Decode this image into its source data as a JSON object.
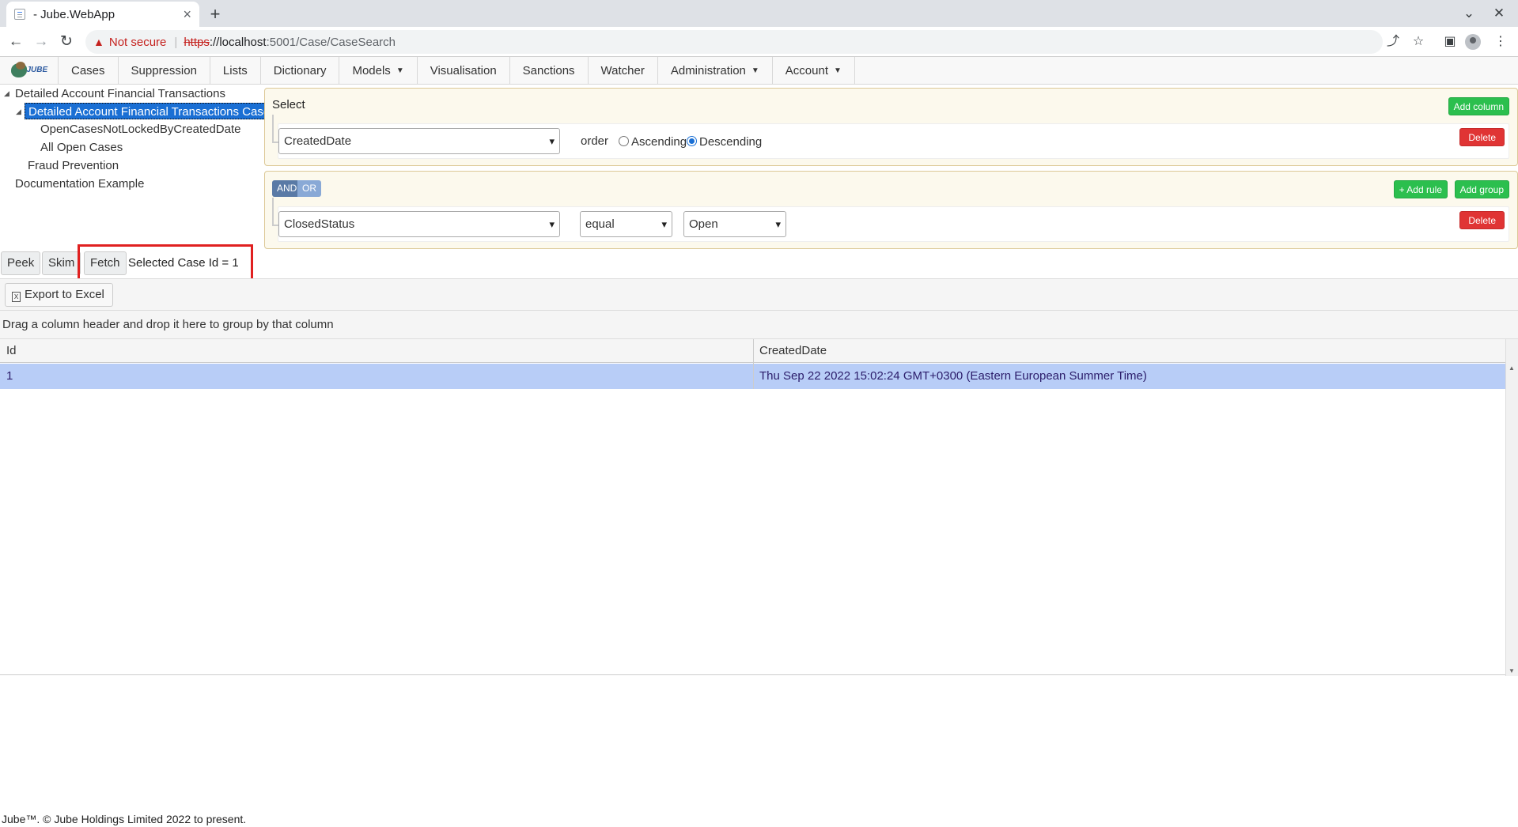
{
  "browser": {
    "tab_title": "- Jube.WebApp",
    "tab_close": "×",
    "new_tab": "+",
    "not_secure": "Not secure",
    "url_scheme": "https",
    "url_host": "://localhost",
    "url_path": ":5001/Case/CaseSearch"
  },
  "menu": {
    "logo_text": "JUBE",
    "items": [
      {
        "label": "Cases",
        "dropdown": false
      },
      {
        "label": "Suppression",
        "dropdown": false
      },
      {
        "label": "Lists",
        "dropdown": false
      },
      {
        "label": "Dictionary",
        "dropdown": false
      },
      {
        "label": "Models",
        "dropdown": true
      },
      {
        "label": "Visualisation",
        "dropdown": false
      },
      {
        "label": "Sanctions",
        "dropdown": false
      },
      {
        "label": "Watcher",
        "dropdown": false
      },
      {
        "label": "Administration",
        "dropdown": true
      },
      {
        "label": "Account",
        "dropdown": true
      }
    ]
  },
  "tree": {
    "root": "Detailed Account Financial Transactions",
    "selected": "Detailed Account Financial Transactions Cases",
    "child1": "OpenCasesNotLockedByCreatedDate",
    "child2": "All Open Cases",
    "sibling": "Fraud Prevention",
    "root2": "Documentation Example"
  },
  "select_builder": {
    "title": "Select",
    "add_column": "Add column",
    "field": "CreatedDate",
    "order_label": "order",
    "ascending": "Ascending",
    "descending": "Descending",
    "delete": "Delete"
  },
  "rule_builder": {
    "and": "AND",
    "or": "OR",
    "add_rule": "+ Add rule",
    "add_group": "Add group",
    "field": "ClosedStatus",
    "operator": "equal",
    "value": "Open",
    "delete": "Delete"
  },
  "actions": {
    "peek": "Peek",
    "skim": "Skim",
    "fetch": "Fetch",
    "selected_case": "Selected Case Id = 1"
  },
  "grid": {
    "export": "Export to Excel",
    "group_hint": "Drag a column header and drop it here to group by that column",
    "columns": [
      "Id",
      "CreatedDate"
    ],
    "rows": [
      {
        "id": "1",
        "created": "Thu Sep 22 2022 15:02:24 GMT+0300 (Eastern European Summer Time)"
      }
    ]
  },
  "footer": "Jube™. © Jube Holdings Limited 2022 to present.",
  "colors": {
    "accent": "#1a6fd4",
    "add": "#2bbf4e",
    "delete": "#e03434",
    "row_selected": "#b8cdf7"
  }
}
